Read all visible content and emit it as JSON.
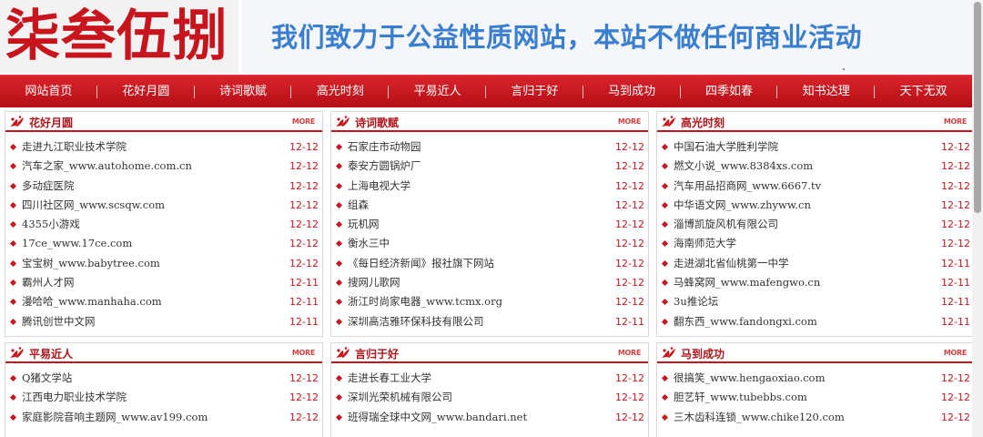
{
  "header": {
    "logo_text": "柒叁伍捌",
    "slogan": "我们致力于公益性质网站，本站不做任何商业活动"
  },
  "nav": {
    "items": [
      "网站首页",
      "花好月圆",
      "诗词歌赋",
      "高光时刻",
      "平易近人",
      "言归于好",
      "马到成功",
      "四季如春",
      "知书达理",
      "天下无双"
    ]
  },
  "more_label": "MORE",
  "sections": [
    {
      "title": "花好月圆",
      "items": [
        {
          "title": "走进九江职业技术学院",
          "date": "12-12"
        },
        {
          "title": "汽车之家_www.autohome.com.cn",
          "date": "12-12"
        },
        {
          "title": "多动症医院",
          "date": "12-12"
        },
        {
          "title": "四川社区网_www.scsqw.com",
          "date": "12-12"
        },
        {
          "title": "4355小游戏",
          "date": "12-12"
        },
        {
          "title": "17ce_www.17ce.com",
          "date": "12-12"
        },
        {
          "title": "宝宝树_www.babytree.com",
          "date": "12-12"
        },
        {
          "title": "霸州人才网",
          "date": "12-11"
        },
        {
          "title": "漫哈哈_www.manhaha.com",
          "date": "12-11"
        },
        {
          "title": "腾讯创世中文网",
          "date": "12-11"
        }
      ]
    },
    {
      "title": "诗词歌赋",
      "items": [
        {
          "title": "石家庄市动物园",
          "date": "12-12"
        },
        {
          "title": "泰安方圆锅炉厂",
          "date": "12-12"
        },
        {
          "title": "上海电视大学",
          "date": "12-12"
        },
        {
          "title": "组森",
          "date": "12-12"
        },
        {
          "title": "玩机网",
          "date": "12-12"
        },
        {
          "title": "衡水三中",
          "date": "12-12"
        },
        {
          "title": "《每日经济新闻》报社旗下网站",
          "date": "12-12"
        },
        {
          "title": "搜网儿歌网",
          "date": "12-12"
        },
        {
          "title": "浙江时尚家电器_www.tcmx.org",
          "date": "12-12"
        },
        {
          "title": "深圳高洁雅环保科技有限公司",
          "date": "12-11"
        }
      ]
    },
    {
      "title": "高光时刻",
      "items": [
        {
          "title": "中国石油大学胜利学院",
          "date": "12-12"
        },
        {
          "title": "燃文小说_www.8384xs.com",
          "date": "12-12"
        },
        {
          "title": "汽车用品招商网_www.6667.tv",
          "date": "12-12"
        },
        {
          "title": "中华语文网_www.zhyww.cn",
          "date": "12-12"
        },
        {
          "title": "淄博凯旋风机有限公司",
          "date": "12-12"
        },
        {
          "title": "海南师范大学",
          "date": "12-12"
        },
        {
          "title": "走进湖北省仙桃第一中学",
          "date": "12-11"
        },
        {
          "title": "马蜂窝网_www.mafengwo.cn",
          "date": "12-11"
        },
        {
          "title": "3u推论坛",
          "date": "12-11"
        },
        {
          "title": "翻东西_www.fandongxi.com",
          "date": "12-11"
        }
      ]
    },
    {
      "title": "平易近人",
      "items": [
        {
          "title": "Q猪文学站",
          "date": "12-12"
        },
        {
          "title": "江西电力职业技术学院",
          "date": "12-12"
        },
        {
          "title": "家庭影院音响主题网_www.av199.com",
          "date": "12-12"
        }
      ]
    },
    {
      "title": "言归于好",
      "items": [
        {
          "title": "走进长春工业大学",
          "date": "12-12"
        },
        {
          "title": "深圳光荣机械有限公司",
          "date": "12-12"
        },
        {
          "title": "班得瑞全球中文网_www.bandari.net",
          "date": "12-12"
        }
      ]
    },
    {
      "title": "马到成功",
      "items": [
        {
          "title": "很搞笑_www.hengaoxiao.com",
          "date": "12-12"
        },
        {
          "title": "胆艺轩_www.tubebbs.com",
          "date": "12-12"
        },
        {
          "title": "三木齿科连锁_www.chike120.com",
          "date": "12-12"
        }
      ]
    }
  ]
}
